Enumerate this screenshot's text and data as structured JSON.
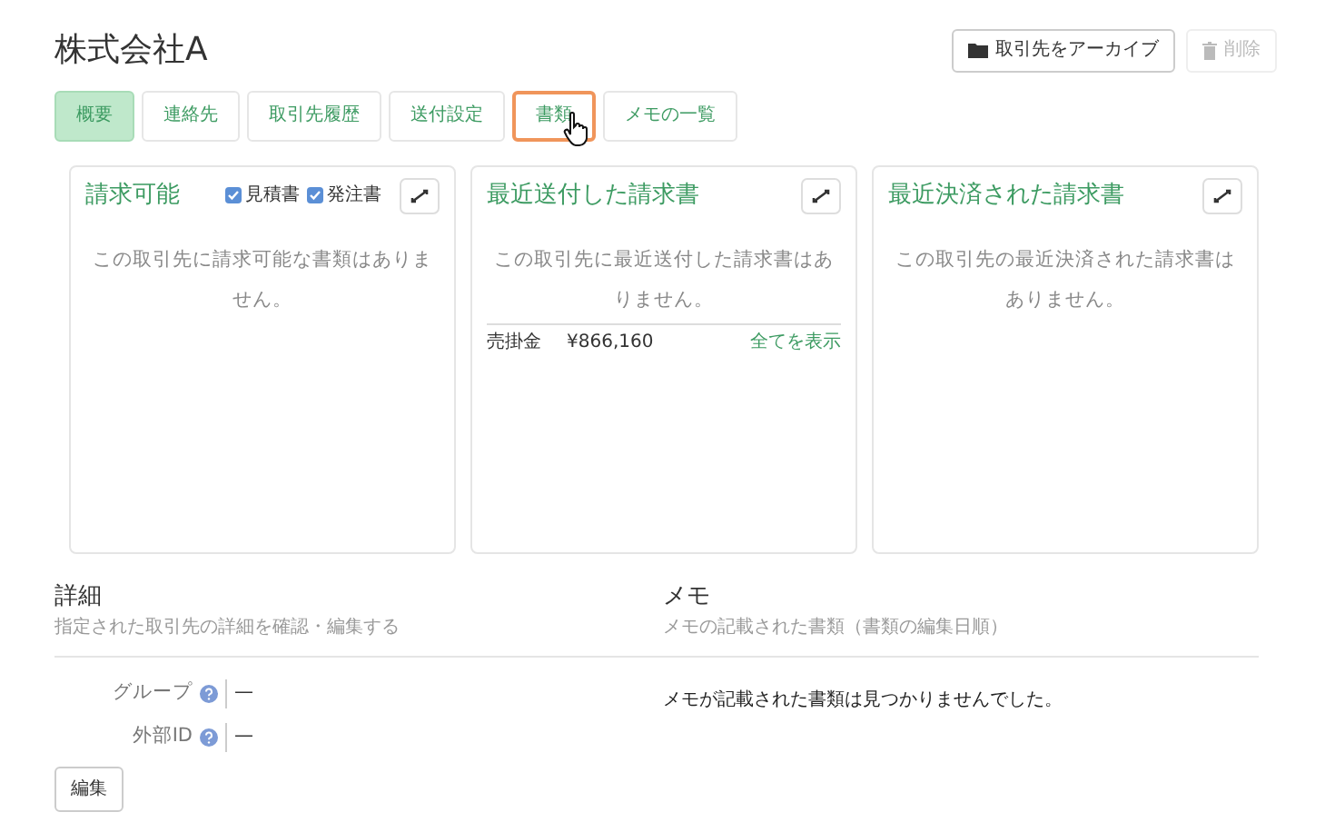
{
  "title": "株式会社A",
  "actions": [
    {
      "label": "取引先をアーカイブ",
      "kind": "archive",
      "disabled": false
    },
    {
      "label": "削除",
      "kind": "delete",
      "disabled": true
    }
  ],
  "tabs": [
    {
      "label": "概要",
      "selected": true,
      "focused": false
    },
    {
      "label": "連絡先",
      "selected": false,
      "focused": false
    },
    {
      "label": "取引先履歴",
      "selected": false,
      "focused": false
    },
    {
      "label": "送付設定",
      "selected": false,
      "focused": false
    },
    {
      "label": "書類",
      "selected": false,
      "focused": true
    },
    {
      "label": "メモの一覧",
      "selected": false,
      "focused": false
    }
  ],
  "cards": [
    {
      "title": "請求可能",
      "filters": [
        {
          "label": "見積書",
          "checked": true
        },
        {
          "label": "発注書",
          "checked": true
        }
      ],
      "empty": "この取引先に請求可能な書類はありません。"
    },
    {
      "title": "最近送付した請求書",
      "empty": "この取引先に最近送付した請求書はありません。",
      "summary": {
        "label": "売掛金",
        "amount": "¥866,160",
        "link": "全てを表示"
      }
    },
    {
      "title": "最近決済された請求書",
      "empty": "この取引先の最近決済された請求書はありません。"
    }
  ],
  "details": {
    "title": "詳細",
    "subtitle": "指定された取引先の詳細を確認・編集する",
    "fields": [
      {
        "label": "グループ",
        "value": "—"
      },
      {
        "label": "外部ID",
        "value": "—"
      }
    ],
    "button": "編集"
  },
  "memo": {
    "title": "メモ",
    "subtitle": "メモの記載された書類（書類の編集日順）",
    "empty": "メモが記載された書類は見つかりませんでした。"
  }
}
